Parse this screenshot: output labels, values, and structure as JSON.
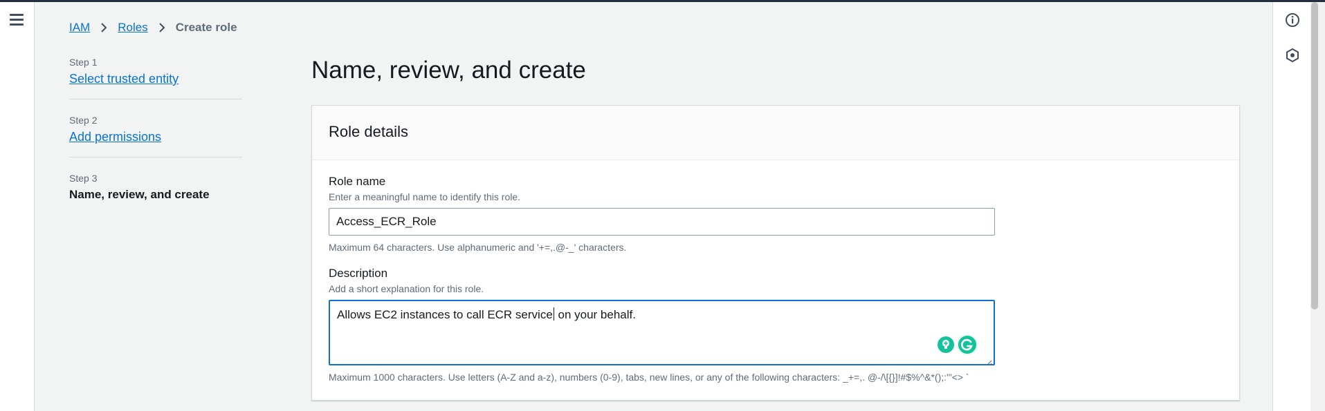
{
  "breadcrumb": {
    "items": [
      "IAM",
      "Roles"
    ],
    "current": "Create role"
  },
  "steps": [
    {
      "number": "Step 1",
      "label": "Select trusted entity"
    },
    {
      "number": "Step 2",
      "label": "Add permissions"
    },
    {
      "number": "Step 3",
      "label": "Name, review, and create"
    }
  ],
  "page": {
    "title": "Name, review, and create"
  },
  "role_details": {
    "header": "Role details",
    "role_name": {
      "label": "Role name",
      "hint": "Enter a meaningful name to identify this role.",
      "value": "Access_ECR_Role",
      "constraint": "Maximum 64 characters. Use alphanumeric and '+=,.@-_' characters."
    },
    "description": {
      "label": "Description",
      "hint": "Add a short explanation for this role.",
      "value_before_cursor": "Allows EC2 instances to call ECR service",
      "value_after_cursor": " on your behalf.",
      "constraint": "Maximum 1000 characters. Use letters (A-Z and a-z), numbers (0-9), tabs, new lines, or any of the following characters: _+=,. @-/\\[{}]!#$%^&*();:'\"<> `"
    }
  },
  "icons": {
    "menu": "hamburger-menu-icon",
    "info": "info-icon",
    "settings": "hexagon-settings-icon",
    "grammarly": "grammarly-icon"
  },
  "colors": {
    "link": "#0972d3",
    "focus": "#0972d3",
    "grammarly": "#15c39a"
  }
}
